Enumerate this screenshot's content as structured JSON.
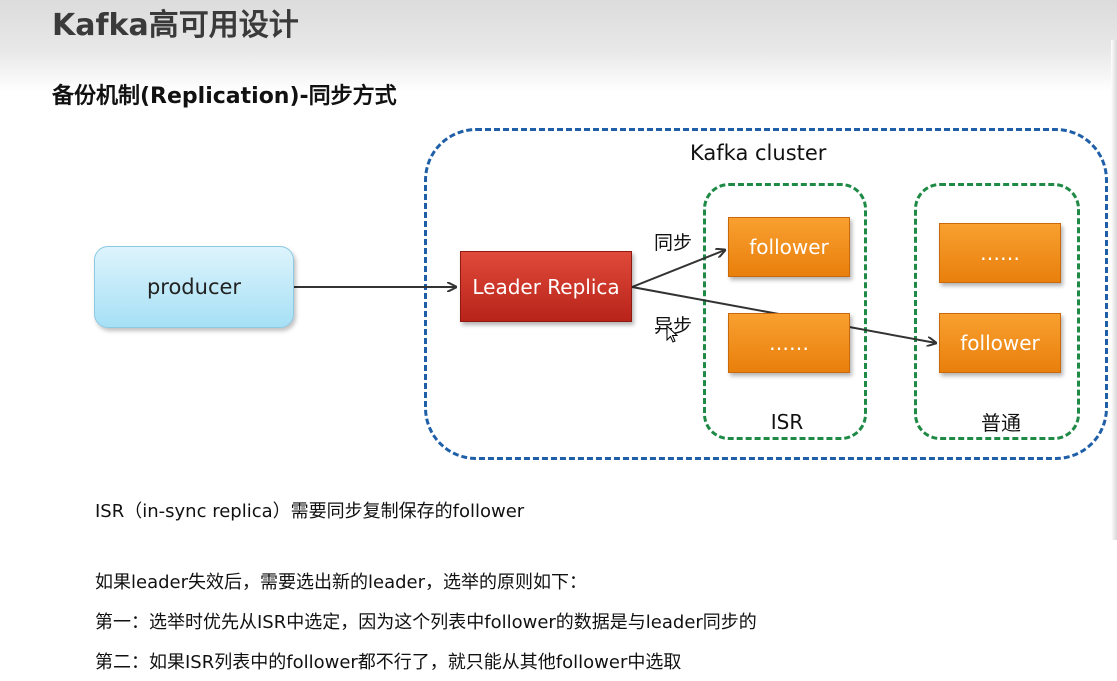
{
  "page": {
    "title": "Kafka高可用设计",
    "subtitle": "备份机制(Replication)-同步方式"
  },
  "diagram": {
    "cluster_label": "Kafka cluster",
    "producer_label": "producer",
    "leader_label": "Leader Replica",
    "isr_group": {
      "label": "ISR",
      "nodes": [
        "follower",
        "……"
      ]
    },
    "normal_group": {
      "label": "普通",
      "nodes": [
        "……",
        "follower"
      ]
    },
    "edges": {
      "sync_label": "同步",
      "async_label": "异步"
    }
  },
  "notes": {
    "isr_definition": "ISR（in-sync replica）需要同步复制保存的follower",
    "election_intro": "如果leader失效后，需要选出新的leader，选举的原则如下：",
    "rule_first": "第一：选举时优先从ISR中选定，因为这个列表中follower的数据是与leader同步的",
    "rule_second": "第二：如果ISR列表中的follower都不行了，就只能从其他follower中选取"
  },
  "colors": {
    "cluster_border": "#1f5fa8",
    "group_border": "#1e8a45",
    "producer_fill": "#a6e0f5",
    "leader_fill": "#c0291e",
    "follower_fill": "#f29122",
    "arrow": "#333333"
  }
}
